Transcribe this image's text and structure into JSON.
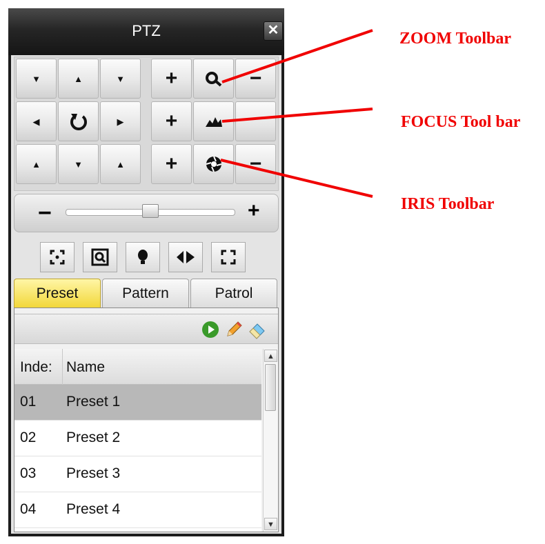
{
  "window": {
    "title": "PTZ",
    "close_label": "✕"
  },
  "direction_pad": {
    "up_left": "▼",
    "up": "▲",
    "up_right": "▼",
    "left": "◀",
    "auto_scan_icon": "rotate-icon",
    "right": "▶",
    "down_left": "▲",
    "down": "▼",
    "down_right": "▲"
  },
  "lens_controls": {
    "zoom": {
      "plus": "+",
      "minus": "−",
      "icon": "zoom-icon"
    },
    "focus": {
      "plus": "+",
      "minus": "",
      "icon": "focus-icon"
    },
    "iris": {
      "plus": "+",
      "minus": "−",
      "icon": "iris-icon"
    }
  },
  "speed_slider": {
    "minus": "−",
    "plus": "+",
    "level": 0.5
  },
  "function_buttons": [
    "3d-positioning-icon",
    "zoom-frame-icon",
    "light-icon",
    "wiper-icon",
    "auto-focus-icon"
  ],
  "tabs": [
    {
      "label": "Preset",
      "active": true
    },
    {
      "label": "Pattern",
      "active": false
    },
    {
      "label": "Patrol",
      "active": false
    }
  ],
  "preset_toolbar": {
    "call_icon": "play-icon",
    "edit_icon": "pencil-icon",
    "delete_icon": "eraser-icon"
  },
  "preset_table": {
    "columns": [
      "Inde:",
      "Name"
    ],
    "rows": [
      {
        "index": "01",
        "name": "Preset 1",
        "selected": true
      },
      {
        "index": "02",
        "name": "Preset 2",
        "selected": false
      },
      {
        "index": "03",
        "name": "Preset 3",
        "selected": false
      },
      {
        "index": "04",
        "name": "Preset 4",
        "selected": false
      }
    ]
  },
  "annotations": {
    "zoom": "ZOOM Toolbar",
    "focus": "FOCUS Tool bar",
    "iris": "IRIS Toolbar",
    "color": "#f00000"
  },
  "colors": {
    "active_tab": "#f2d73a",
    "selected_row": "#b8b8b8",
    "title_bar": "#262626"
  }
}
